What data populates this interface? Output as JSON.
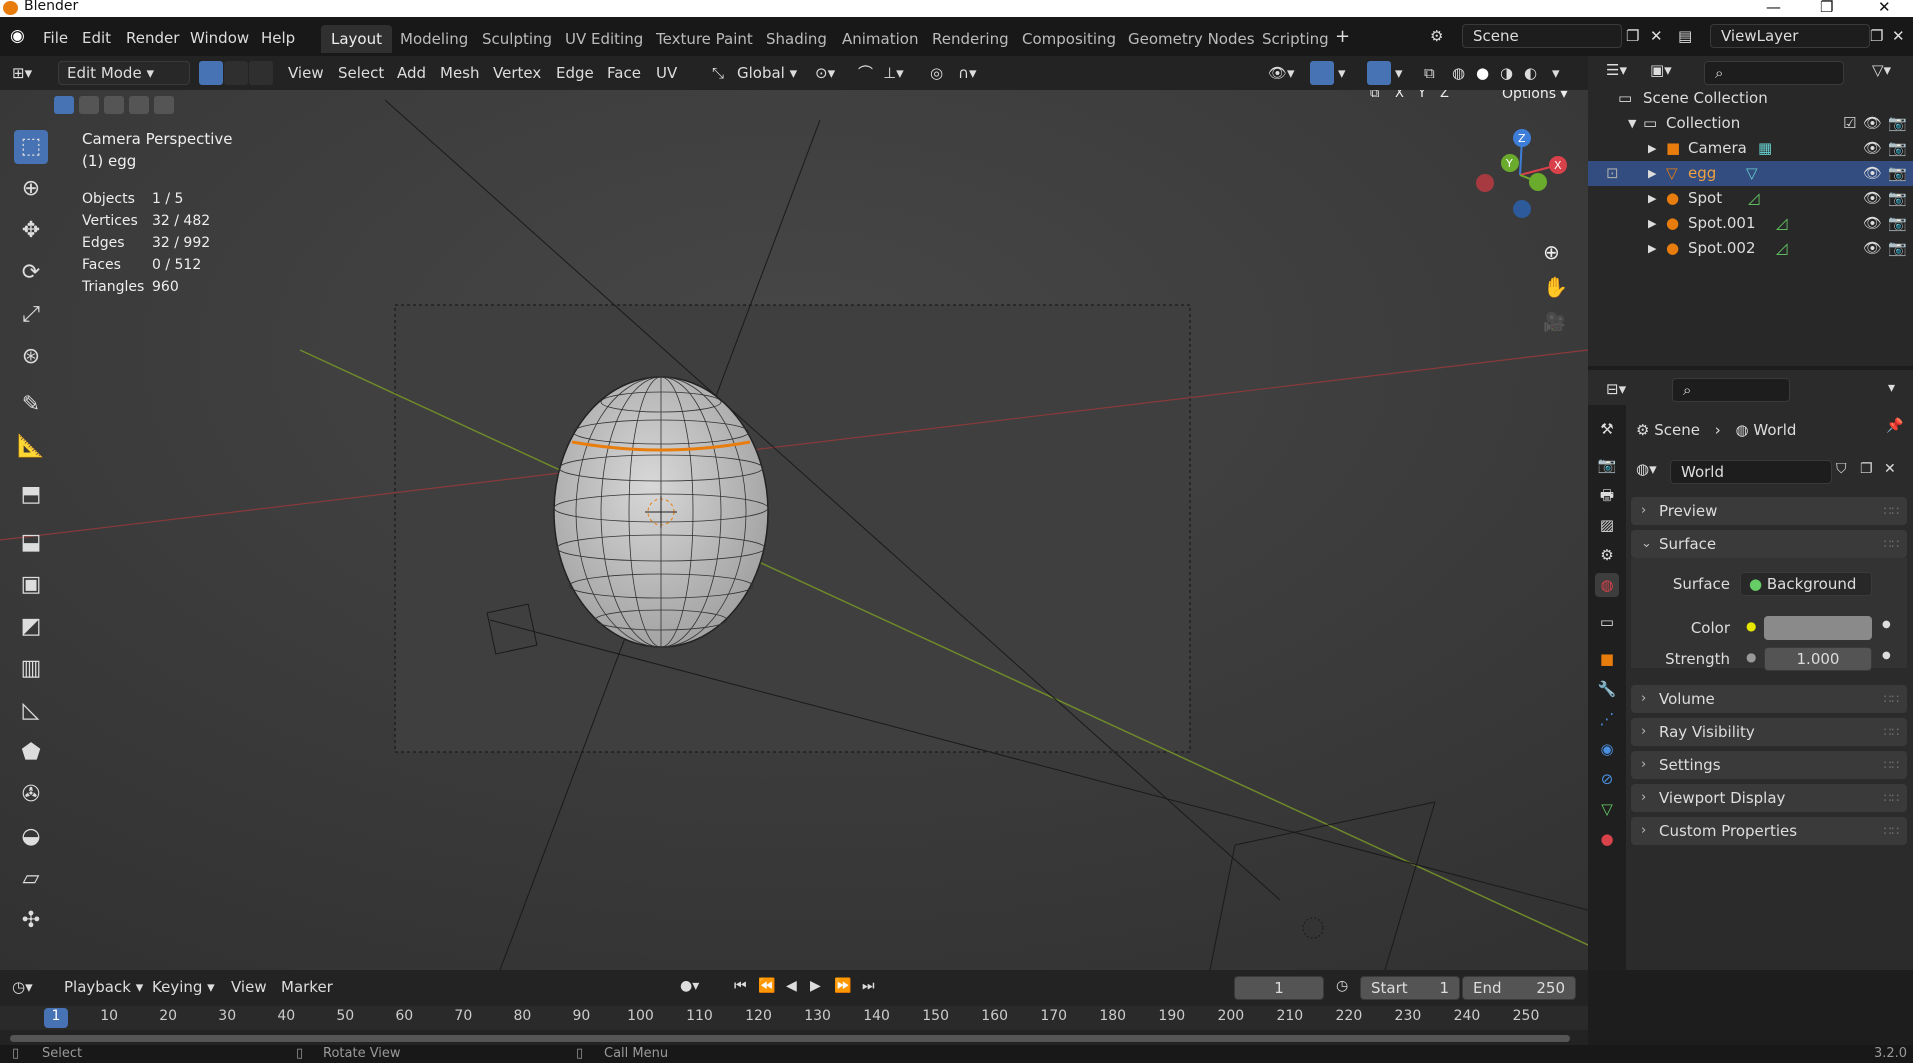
{
  "titlebar": {
    "title": "Blender"
  },
  "menus": [
    "File",
    "Edit",
    "Render",
    "Window",
    "Help"
  ],
  "workspaces": [
    "Layout",
    "Modeling",
    "Sculpting",
    "UV Editing",
    "Texture Paint",
    "Shading",
    "Animation",
    "Rendering",
    "Compositing",
    "Geometry Nodes",
    "Scripting"
  ],
  "active_workspace": "Layout",
  "scene": {
    "name": "Scene"
  },
  "view_layer": {
    "name": "ViewLayer"
  },
  "header3d": {
    "mode": "Edit Mode",
    "menus": [
      "View",
      "Select",
      "Add",
      "Mesh",
      "Vertex",
      "Edge",
      "Face",
      "UV"
    ],
    "orientation": "Global",
    "options": "Options",
    "axes": [
      "X",
      "Y",
      "Z"
    ]
  },
  "viewport": {
    "title": "Camera Perspective",
    "object": "(1) egg",
    "stats": [
      {
        "label": "Objects",
        "value": "1 / 5"
      },
      {
        "label": "Vertices",
        "value": "32 / 482"
      },
      {
        "label": "Edges",
        "value": "32 / 992"
      },
      {
        "label": "Faces",
        "value": "0 / 512"
      },
      {
        "label": "Triangles",
        "value": "960"
      }
    ],
    "gizmo": {
      "x": "X",
      "y": "Y",
      "z": "Z"
    }
  },
  "outliner": {
    "root": "Scene Collection",
    "collection": "Collection",
    "items": [
      {
        "name": "Camera",
        "selected": false
      },
      {
        "name": "egg",
        "selected": true
      },
      {
        "name": "Spot",
        "selected": false
      },
      {
        "name": "Spot.001",
        "selected": false
      },
      {
        "name": "Spot.002",
        "selected": false
      }
    ]
  },
  "properties": {
    "breadcrumb": [
      "Scene",
      "World"
    ],
    "world_name": "World",
    "panels": {
      "preview": "Preview",
      "surface": "Surface",
      "volume": "Volume",
      "ray_visibility": "Ray Visibility",
      "settings": "Settings",
      "viewport_display": "Viewport Display",
      "custom_properties": "Custom Properties"
    },
    "surface_label": "Surface",
    "surface_value": "Background",
    "color_label": "Color",
    "color_value": "#8a8a8a",
    "strength_label": "Strength",
    "strength_value": "1.000"
  },
  "timeline": {
    "menus": [
      "Playback",
      "Keying",
      "View",
      "Marker"
    ],
    "current_frame": "1",
    "start_label": "Start",
    "start": "1",
    "end_label": "End",
    "end": "250",
    "ticks": [
      "1",
      "10",
      "20",
      "30",
      "40",
      "50",
      "60",
      "70",
      "80",
      "90",
      "100",
      "110",
      "120",
      "130",
      "140",
      "150",
      "160",
      "170",
      "180",
      "190",
      "200",
      "210",
      "220",
      "230",
      "240",
      "250"
    ]
  },
  "statusbar": {
    "select": "Select",
    "rotate": "Rotate View",
    "call_menu": "Call Menu",
    "version": "3.2.0"
  },
  "colors": {
    "accent": "#4772b3",
    "selection_orange": "#e87d0d",
    "background": "#1d1d1d"
  }
}
